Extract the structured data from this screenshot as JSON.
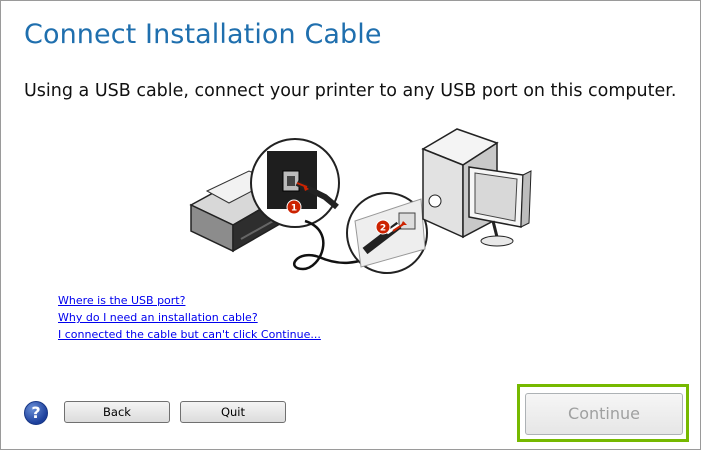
{
  "header": {
    "title": "Connect Installation Cable",
    "instruction": "Using a USB cable, connect your printer to any USB port on this computer."
  },
  "illustration": {
    "step_markers": [
      "1",
      "2"
    ]
  },
  "help_links": [
    "Where is the USB port?",
    "Why do I need an installation cable?",
    "I connected the cable but can't click Continue..."
  ],
  "footer": {
    "help_icon": "question-mark-icon",
    "help_glyph": "?",
    "back_label": "Back",
    "quit_label": "Quit",
    "continue_label": "Continue",
    "continue_enabled": false
  },
  "colors": {
    "title": "#1f6fae",
    "link": "#0000ee",
    "highlight": "#76b900",
    "marker": "#cc2200"
  }
}
